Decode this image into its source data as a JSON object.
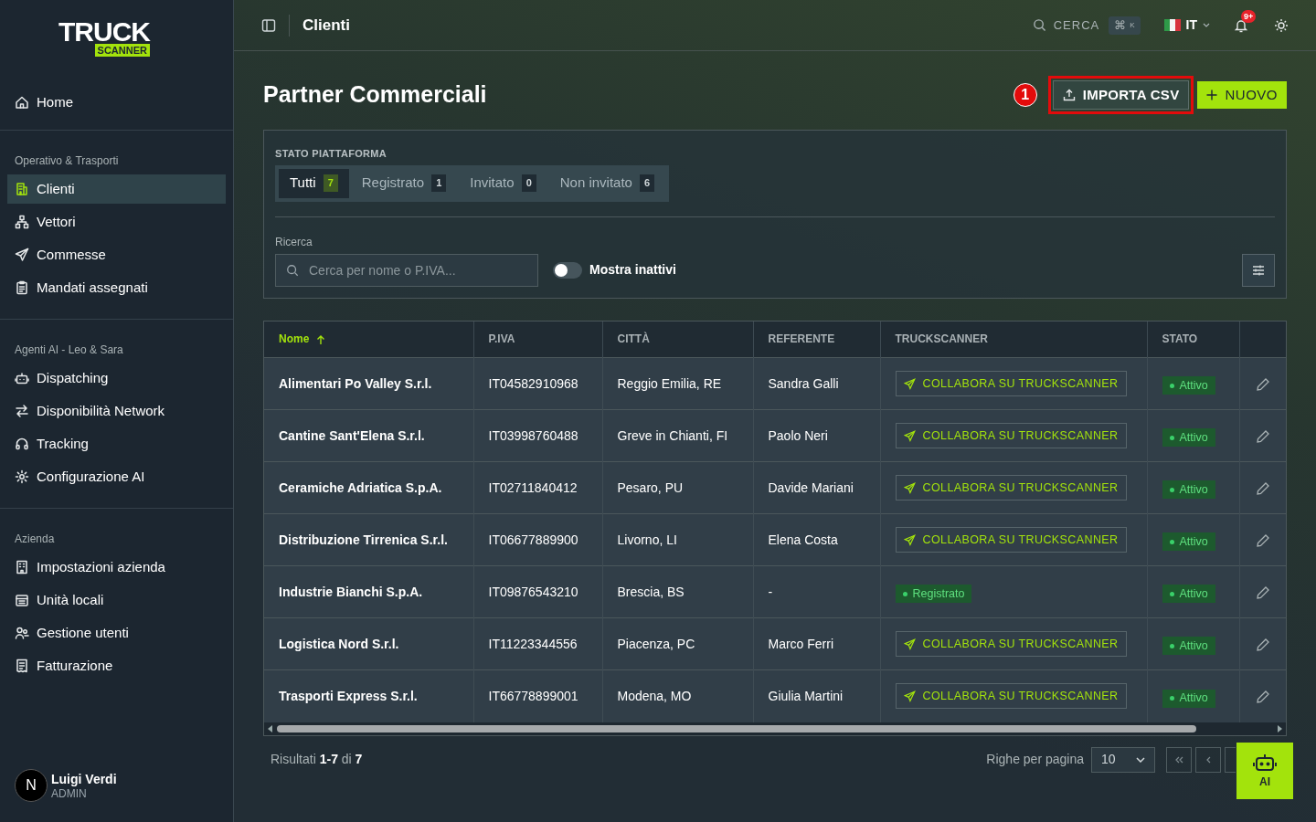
{
  "logo": {
    "word": "TRUCK",
    "tag": "SCANNER"
  },
  "sidebar": {
    "top": [
      {
        "label": "Home",
        "selected": false
      }
    ],
    "sections": [
      {
        "title": "Operativo & Trasporti",
        "items": [
          {
            "label": "Clienti",
            "selected": true
          },
          {
            "label": "Vettori",
            "selected": false
          },
          {
            "label": "Commesse",
            "selected": false
          },
          {
            "label": "Mandati assegnati",
            "selected": false
          }
        ]
      },
      {
        "title": "Agenti AI - Leo & Sara",
        "items": [
          {
            "label": "Dispatching",
            "selected": false
          },
          {
            "label": "Disponibilità Network",
            "selected": false
          },
          {
            "label": "Tracking",
            "selected": false
          },
          {
            "label": "Configurazione AI",
            "selected": false
          }
        ]
      },
      {
        "title": "Azienda",
        "items": [
          {
            "label": "Impostazioni azienda",
            "selected": false
          },
          {
            "label": "Unità locali",
            "selected": false
          },
          {
            "label": "Gestione utenti",
            "selected": false
          },
          {
            "label": "Fatturazione",
            "selected": false
          }
        ]
      }
    ],
    "user": {
      "initial": "N",
      "name": "Luigi Verdi",
      "role": "ADMIN"
    }
  },
  "header": {
    "title": "Clienti",
    "search": "CERCA",
    "shortcut": "⌘",
    "shortcut_key": "K",
    "language": "IT",
    "notifications": "9+"
  },
  "page": {
    "title": "Partner Commerciali",
    "annotation": "1",
    "buttons": [
      {
        "label": "IMPORTA CSV",
        "kind": "secondary"
      },
      {
        "label": "NUOVO",
        "kind": "primary"
      }
    ]
  },
  "filters": {
    "title": "STATO PIATTAFORMA",
    "tabs": [
      {
        "label": "Tutti",
        "count": "7",
        "selected": true
      },
      {
        "label": "Registrato",
        "count": "1",
        "selected": false
      },
      {
        "label": "Invitato",
        "count": "0",
        "selected": false
      },
      {
        "label": "Non invitato",
        "count": "6",
        "selected": false
      }
    ],
    "search_label": "Ricerca",
    "search_placeholder": "Cerca per nome o P.IVA...",
    "toggle": {
      "label": "Mostra inattivi",
      "on": false
    }
  },
  "table": {
    "columns": [
      {
        "label": "Nome",
        "sorted": true
      },
      {
        "label": "P.IVA",
        "sorted": false
      },
      {
        "label": "CITTÀ",
        "sorted": false
      },
      {
        "label": "REFERENTE",
        "sorted": false
      },
      {
        "label": "TRUCKSCANNER",
        "sorted": false
      },
      {
        "label": "STATO",
        "sorted": false
      }
    ],
    "rows": [
      {
        "name": "Alimentari Po Valley S.r.l.",
        "piva": "IT04582910968",
        "city": "Reggio Emilia, RE",
        "contact": "Sandra Galli",
        "truckscanner": {
          "kind": "invite",
          "label": "COLLABORA SU TRUCKSCANNER"
        },
        "status": "Attivo"
      },
      {
        "name": "Cantine Sant'Elena S.r.l.",
        "piva": "IT03998760488",
        "city": "Greve in Chianti, FI",
        "contact": "Paolo Neri",
        "truckscanner": {
          "kind": "invite",
          "label": "COLLABORA SU TRUCKSCANNER"
        },
        "status": "Attivo"
      },
      {
        "name": "Ceramiche Adriatica S.p.A.",
        "piva": "IT02711840412",
        "city": "Pesaro, PU",
        "contact": "Davide Mariani",
        "truckscanner": {
          "kind": "invite",
          "label": "COLLABORA SU TRUCKSCANNER"
        },
        "status": "Attivo"
      },
      {
        "name": "Distribuzione Tirrenica S.r.l.",
        "piva": "IT06677889900",
        "city": "Livorno, LI",
        "contact": "Elena Costa",
        "truckscanner": {
          "kind": "invite",
          "label": "COLLABORA SU TRUCKSCANNER"
        },
        "status": "Attivo"
      },
      {
        "name": "Industrie Bianchi S.p.A.",
        "piva": "IT09876543210",
        "city": "Brescia, BS",
        "contact": "-",
        "truckscanner": {
          "kind": "registered",
          "label": "Registrato"
        },
        "status": "Attivo"
      },
      {
        "name": "Logistica Nord S.r.l.",
        "piva": "IT11223344556",
        "city": "Piacenza, PC",
        "contact": "Marco Ferri",
        "truckscanner": {
          "kind": "invite",
          "label": "COLLABORA SU TRUCKSCANNER"
        },
        "status": "Attivo"
      },
      {
        "name": "Trasporti Express S.r.l.",
        "piva": "IT66778899001",
        "city": "Modena, MO",
        "contact": "Giulia Martini",
        "truckscanner": {
          "kind": "invite",
          "label": "COLLABORA SU TRUCKSCANNER"
        },
        "status": "Attivo"
      }
    ]
  },
  "footer": {
    "results": "Risultati **1-7** di **7**",
    "rows_label": "Righe per pagina",
    "rows_value": "10"
  },
  "ai_button": "AI"
}
